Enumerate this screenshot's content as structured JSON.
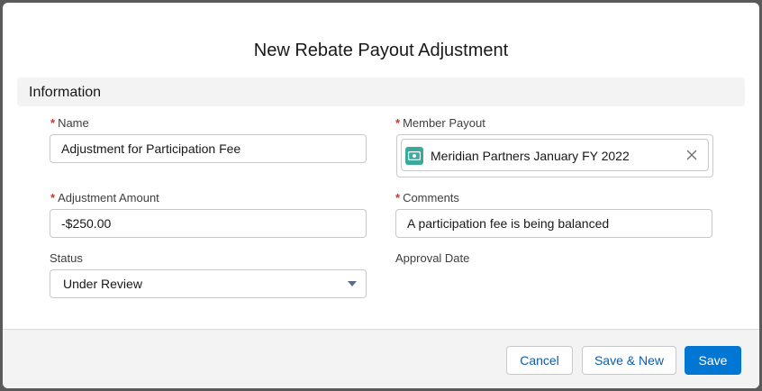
{
  "modal": {
    "title": "New Rebate Payout Adjustment",
    "section_title": "Information"
  },
  "fields": {
    "name": {
      "label": "Name",
      "required": "*",
      "value": "Adjustment for Participation Fee"
    },
    "member_payout": {
      "label": "Member Payout",
      "required": "*",
      "value": "Meridian Partners January FY 2022",
      "icon": "payout-record-icon"
    },
    "adjustment_amount": {
      "label": "Adjustment Amount",
      "required": "*",
      "value": "-$250.00"
    },
    "comments": {
      "label": "Comments",
      "required": "*",
      "value": "A participation fee is being balanced"
    },
    "status": {
      "label": "Status",
      "value": "Under Review"
    },
    "approval_date": {
      "label": "Approval Date"
    }
  },
  "footer": {
    "cancel_label": "Cancel",
    "save_new_label": "Save & New",
    "save_label": "Save"
  },
  "colors": {
    "brand": "#0176d3",
    "required": "#c23934",
    "record_icon": "#3ba99c"
  }
}
